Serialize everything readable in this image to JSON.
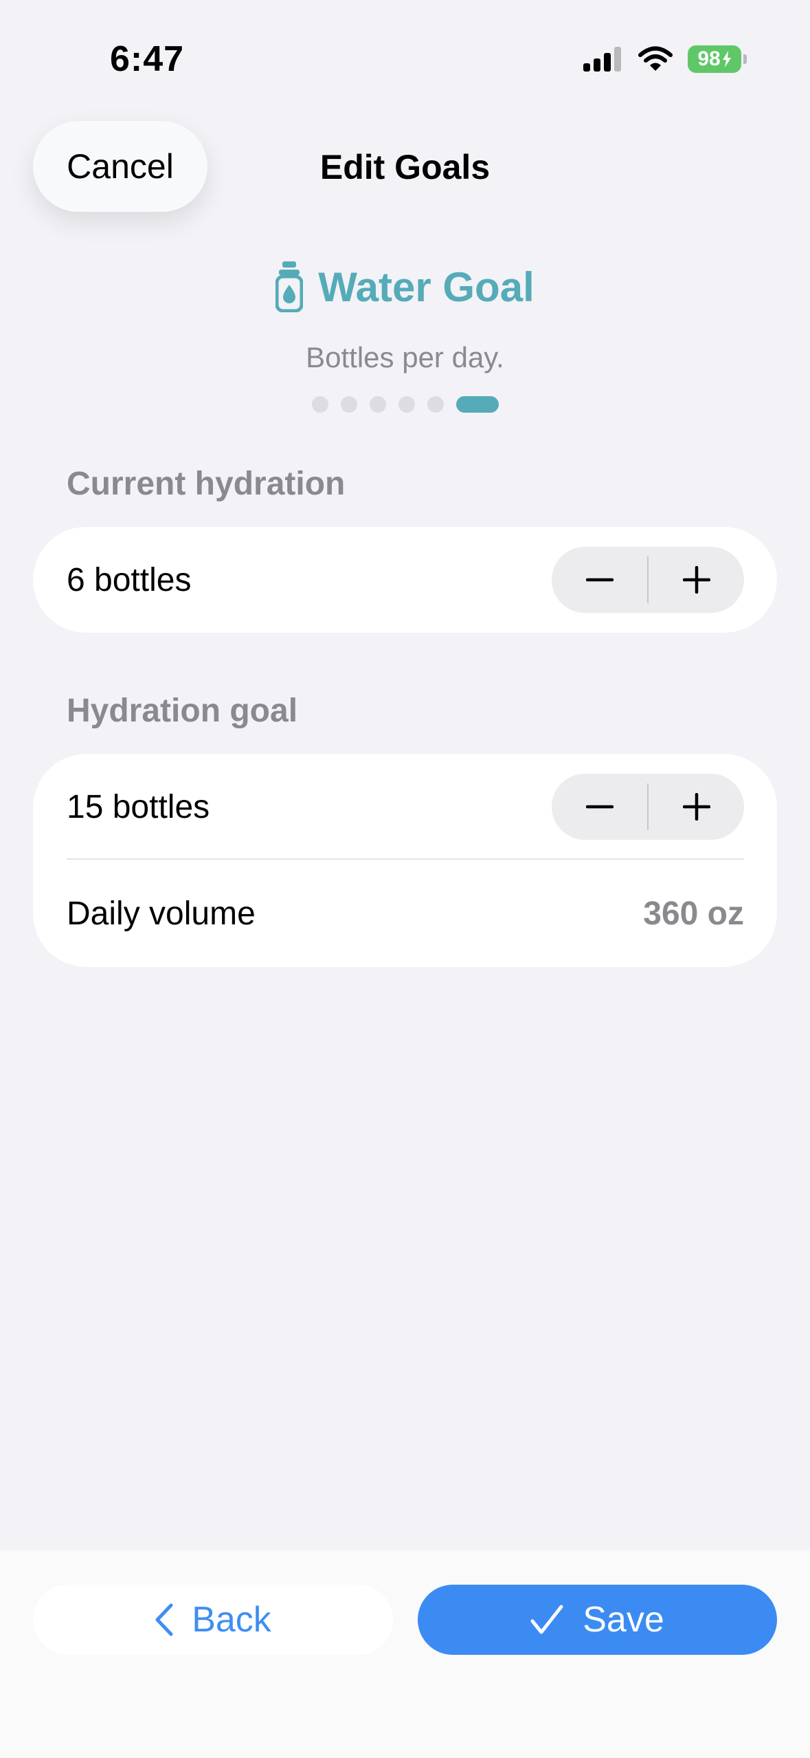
{
  "status_bar": {
    "time": "6:47",
    "battery_level": "98"
  },
  "header": {
    "cancel_label": "Cancel",
    "title": "Edit Goals"
  },
  "goal": {
    "icon": "water-bottle-icon",
    "title": "Water Goal",
    "subtitle": "Bottles per day."
  },
  "pagination": {
    "total": 6,
    "active_index": 5
  },
  "current_hydration": {
    "section_label": "Current hydration",
    "value": "6 bottles"
  },
  "hydration_goal": {
    "section_label": "Hydration goal",
    "value": "15 bottles",
    "daily_volume_label": "Daily volume",
    "daily_volume_value": "360 oz"
  },
  "footer": {
    "back_label": "Back",
    "save_label": "Save"
  },
  "colors": {
    "accent_teal": "#55abb8",
    "primary_blue": "#3b8bf3",
    "battery_green": "#5fc768",
    "background": "#f2f2f7"
  }
}
